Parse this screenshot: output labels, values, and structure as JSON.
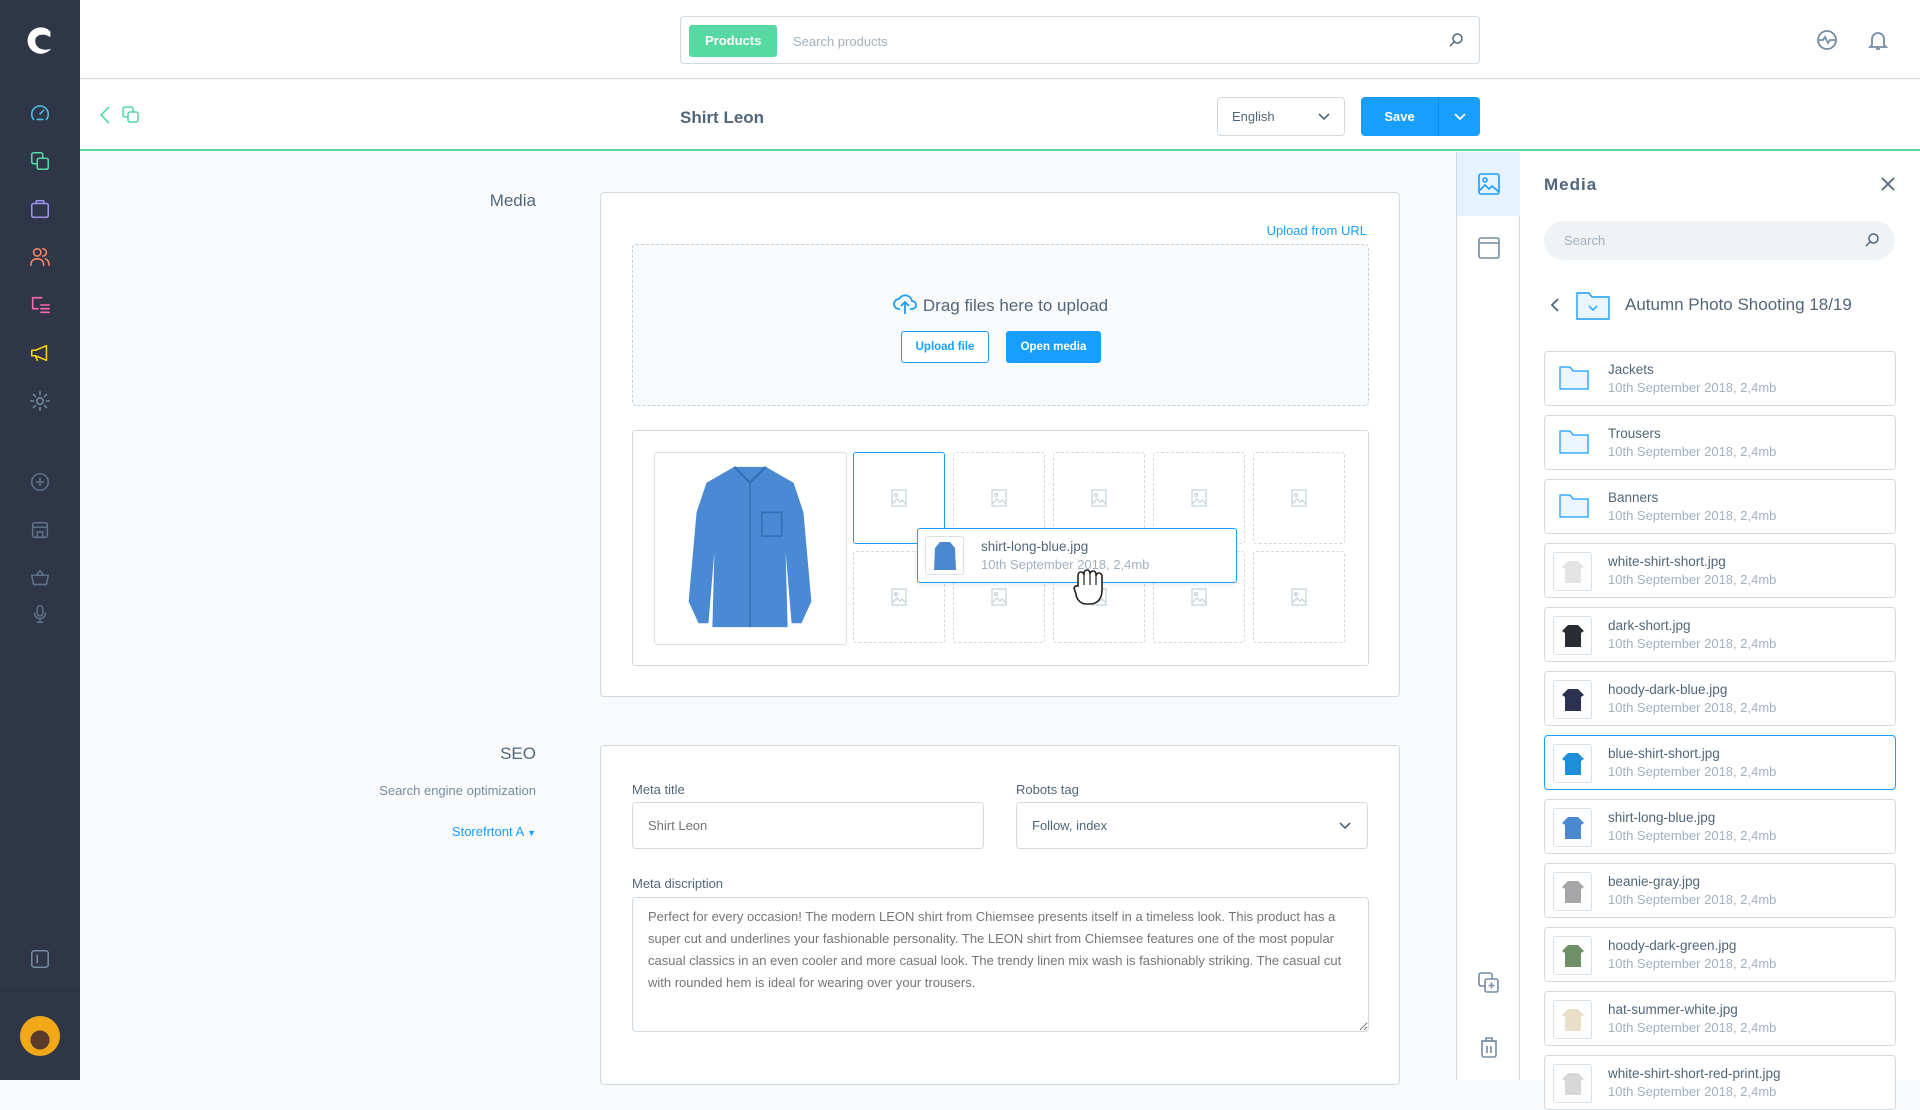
{
  "colors": {
    "accent": "#189eff",
    "brand_green": "#57d9a3",
    "nav_bg": "#2e3648",
    "text": "#52667a",
    "muted": "#a2b1bf"
  },
  "nav": {
    "logo": "shopware-logo",
    "items": [
      {
        "name": "dashboard",
        "icon": "gauge-icon",
        "color": "#4dc1e5"
      },
      {
        "name": "catalogues",
        "icon": "stack-icon",
        "color": "#57d9a3"
      },
      {
        "name": "orders",
        "icon": "bag-icon",
        "color": "#a092f0"
      },
      {
        "name": "customers",
        "icon": "users-icon",
        "color": "#f88962"
      },
      {
        "name": "content",
        "icon": "content-icon",
        "color": "#ff68b4"
      },
      {
        "name": "marketing",
        "icon": "megaphone-icon",
        "color": "#ffd700"
      },
      {
        "name": "settings",
        "icon": "gear-icon",
        "color": "#758ca3"
      }
    ],
    "extras": [
      {
        "name": "add",
        "icon": "plus-circle-icon"
      },
      {
        "name": "storefront",
        "icon": "store-icon"
      },
      {
        "name": "basket",
        "icon": "basket-icon"
      },
      {
        "name": "voice",
        "icon": "microphone-icon"
      }
    ],
    "collapse_icon": "sidebar-collapse-icon",
    "avatar": "user-avatar"
  },
  "topbar": {
    "search_type": "Products",
    "search_placeholder": "Search products",
    "icons": [
      "activity-icon",
      "bell-icon"
    ]
  },
  "subheader": {
    "title": "Shirt Leon",
    "language": "English",
    "save_label": "Save"
  },
  "media_section": {
    "label": "Media",
    "upload_from_url": "Upload from URL",
    "drag_text": "Drag files here to upload",
    "upload_file": "Upload file",
    "open_media": "Open media",
    "dragging": {
      "name": "shirt-long-blue.jpg",
      "meta": "10th September 2018, 2,4mb"
    }
  },
  "seo_section": {
    "label": "SEO",
    "sublabel": "Search engine optimization",
    "storefront": "Storefrtont A",
    "meta_title_label": "Meta title",
    "meta_title_placeholder": "Shirt Leon",
    "robots_label": "Robots tag",
    "robots_value": "Follow, index",
    "meta_desc_label": "Meta discription",
    "meta_desc_placeholder": "Perfect for every occasion! The modern LEON shirt from Chiemsee presents itself in a timeless look. This product has a super cut and underlines your fashionable personality. The LEON shirt from Chiemsee features one of the most popular casual classics in an even cooler and more casual look. The trendy linen mix wash is fashionably striking. The casual cut with rounded hem is ideal for wearing over your trousers."
  },
  "media_panel": {
    "title": "Media",
    "search_placeholder": "Search",
    "folder": "Autumn Photo Shooting 18/19",
    "items": [
      {
        "name": "Jackets",
        "meta": "10th September 2018, 2,4mb",
        "type": "folder"
      },
      {
        "name": "Trousers",
        "meta": "10th September 2018, 2,4mb",
        "type": "folder"
      },
      {
        "name": "Banners",
        "meta": "10th September 2018, 2,4mb",
        "type": "folder"
      },
      {
        "name": "white-shirt-short.jpg",
        "meta": "10th September 2018, 2,4mb",
        "type": "image",
        "thumb_color": "#e4e4e4"
      },
      {
        "name": "dark-short.jpg",
        "meta": "10th September 2018, 2,4mb",
        "type": "image",
        "thumb_color": "#2a2c33"
      },
      {
        "name": "hoody-dark-blue.jpg",
        "meta": "10th September 2018, 2,4mb",
        "type": "image",
        "thumb_color": "#2c3152"
      },
      {
        "name": "blue-shirt-short.jpg",
        "meta": "10th September 2018, 2,4mb",
        "type": "image",
        "thumb_color": "#1e8ed6",
        "selected": true
      },
      {
        "name": "shirt-long-blue.jpg",
        "meta": "10th September 2018, 2,4mb",
        "type": "image",
        "thumb_color": "#4a88cf"
      },
      {
        "name": "beanie-gray.jpg",
        "meta": "10th September 2018, 2,4mb",
        "type": "image",
        "thumb_color": "#a6a6a8"
      },
      {
        "name": "hoody-dark-green.jpg",
        "meta": "10th September 2018, 2,4mb",
        "type": "image",
        "thumb_color": "#6f8f66"
      },
      {
        "name": "hat-summer-white.jpg",
        "meta": "10th September 2018, 2,4mb",
        "type": "image",
        "thumb_color": "#e9dfc8"
      },
      {
        "name": "white-shirt-short-red-print.jpg",
        "meta": "10th September 2018, 2,4mb",
        "type": "image",
        "thumb_color": "#d8d8d8"
      }
    ]
  }
}
